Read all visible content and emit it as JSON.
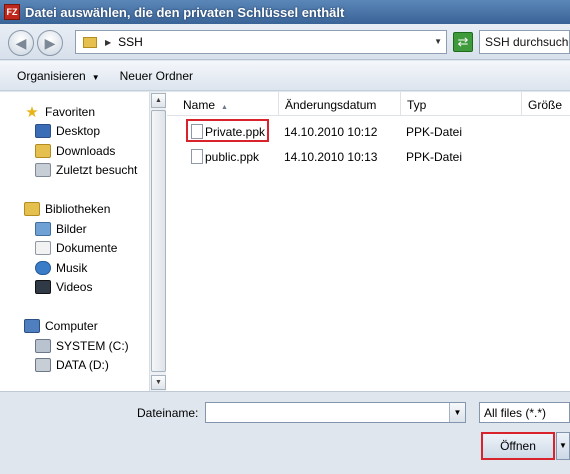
{
  "window": {
    "title": "Datei auswählen, die den privaten Schlüssel enthält",
    "app_icon_label": "FZ"
  },
  "address_bar": {
    "path": "SSH",
    "search_placeholder": "SSH durchsuchen"
  },
  "toolbar": {
    "organize_label": "Organisieren",
    "new_folder_label": "Neuer Ordner"
  },
  "sidebar": {
    "groups": [
      {
        "label": "Favoriten",
        "items": [
          "Desktop",
          "Downloads",
          "Zuletzt besucht"
        ]
      },
      {
        "label": "Bibliotheken",
        "items": [
          "Bilder",
          "Dokumente",
          "Musik",
          "Videos"
        ]
      },
      {
        "label": "Computer",
        "items": [
          "SYSTEM (C:)",
          "DATA (D:)"
        ]
      }
    ]
  },
  "file_list": {
    "columns": [
      "Name",
      "Änderungsdatum",
      "Typ",
      "Größe"
    ],
    "rows": [
      {
        "name": "Private.ppk",
        "date": "14.10.2010 10:12",
        "type": "PPK-Datei"
      },
      {
        "name": "public.ppk",
        "date": "14.10.2010 10:13",
        "type": "PPK-Datei"
      }
    ]
  },
  "footer": {
    "filename_label": "Dateiname:",
    "filename_value": "",
    "filter_value": "All files (*.*)",
    "open_button": "Öffnen"
  },
  "colors": {
    "highlight": "#d8232c",
    "titlebar": "#3a6497"
  }
}
